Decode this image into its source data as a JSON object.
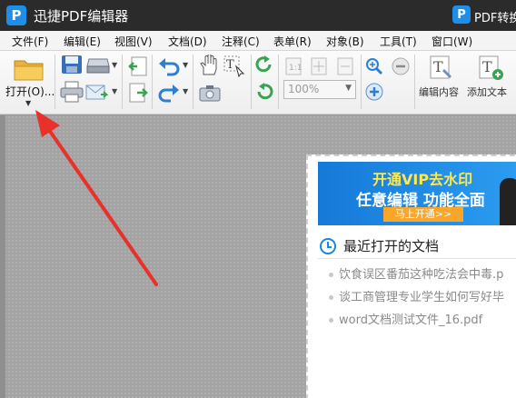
{
  "app": {
    "logo_letter": "P",
    "title": "迅捷PDF编辑器",
    "promo_logo_letter": "P",
    "promo_text": "PDF转换"
  },
  "menu": [
    "文件(F)",
    "编辑(E)",
    "视图(V)",
    "文档(D)",
    "注释(C)",
    "表单(R)",
    "对象(B)",
    "工具(T)",
    "窗口(W)"
  ],
  "toolbar": {
    "open_label": "打开(O)...",
    "zoom_value": "100%",
    "edit_content_label": "编辑内容",
    "add_text_label": "添加文本"
  },
  "banner": {
    "line1": "开通VIP去水印",
    "line2": "任意编辑  功能全面",
    "button": "马上开通>>"
  },
  "recent": {
    "title": "最近打开的文档",
    "items": [
      "饮食误区番茄这种吃法会中毒.p",
      "谈工商管理专业学生如何写好毕",
      "word文档测试文件_16.pdf"
    ]
  },
  "colors": {
    "accent": "#1a86e0",
    "arrow": "#e8312b",
    "titlebar": "#2b2b2b"
  }
}
